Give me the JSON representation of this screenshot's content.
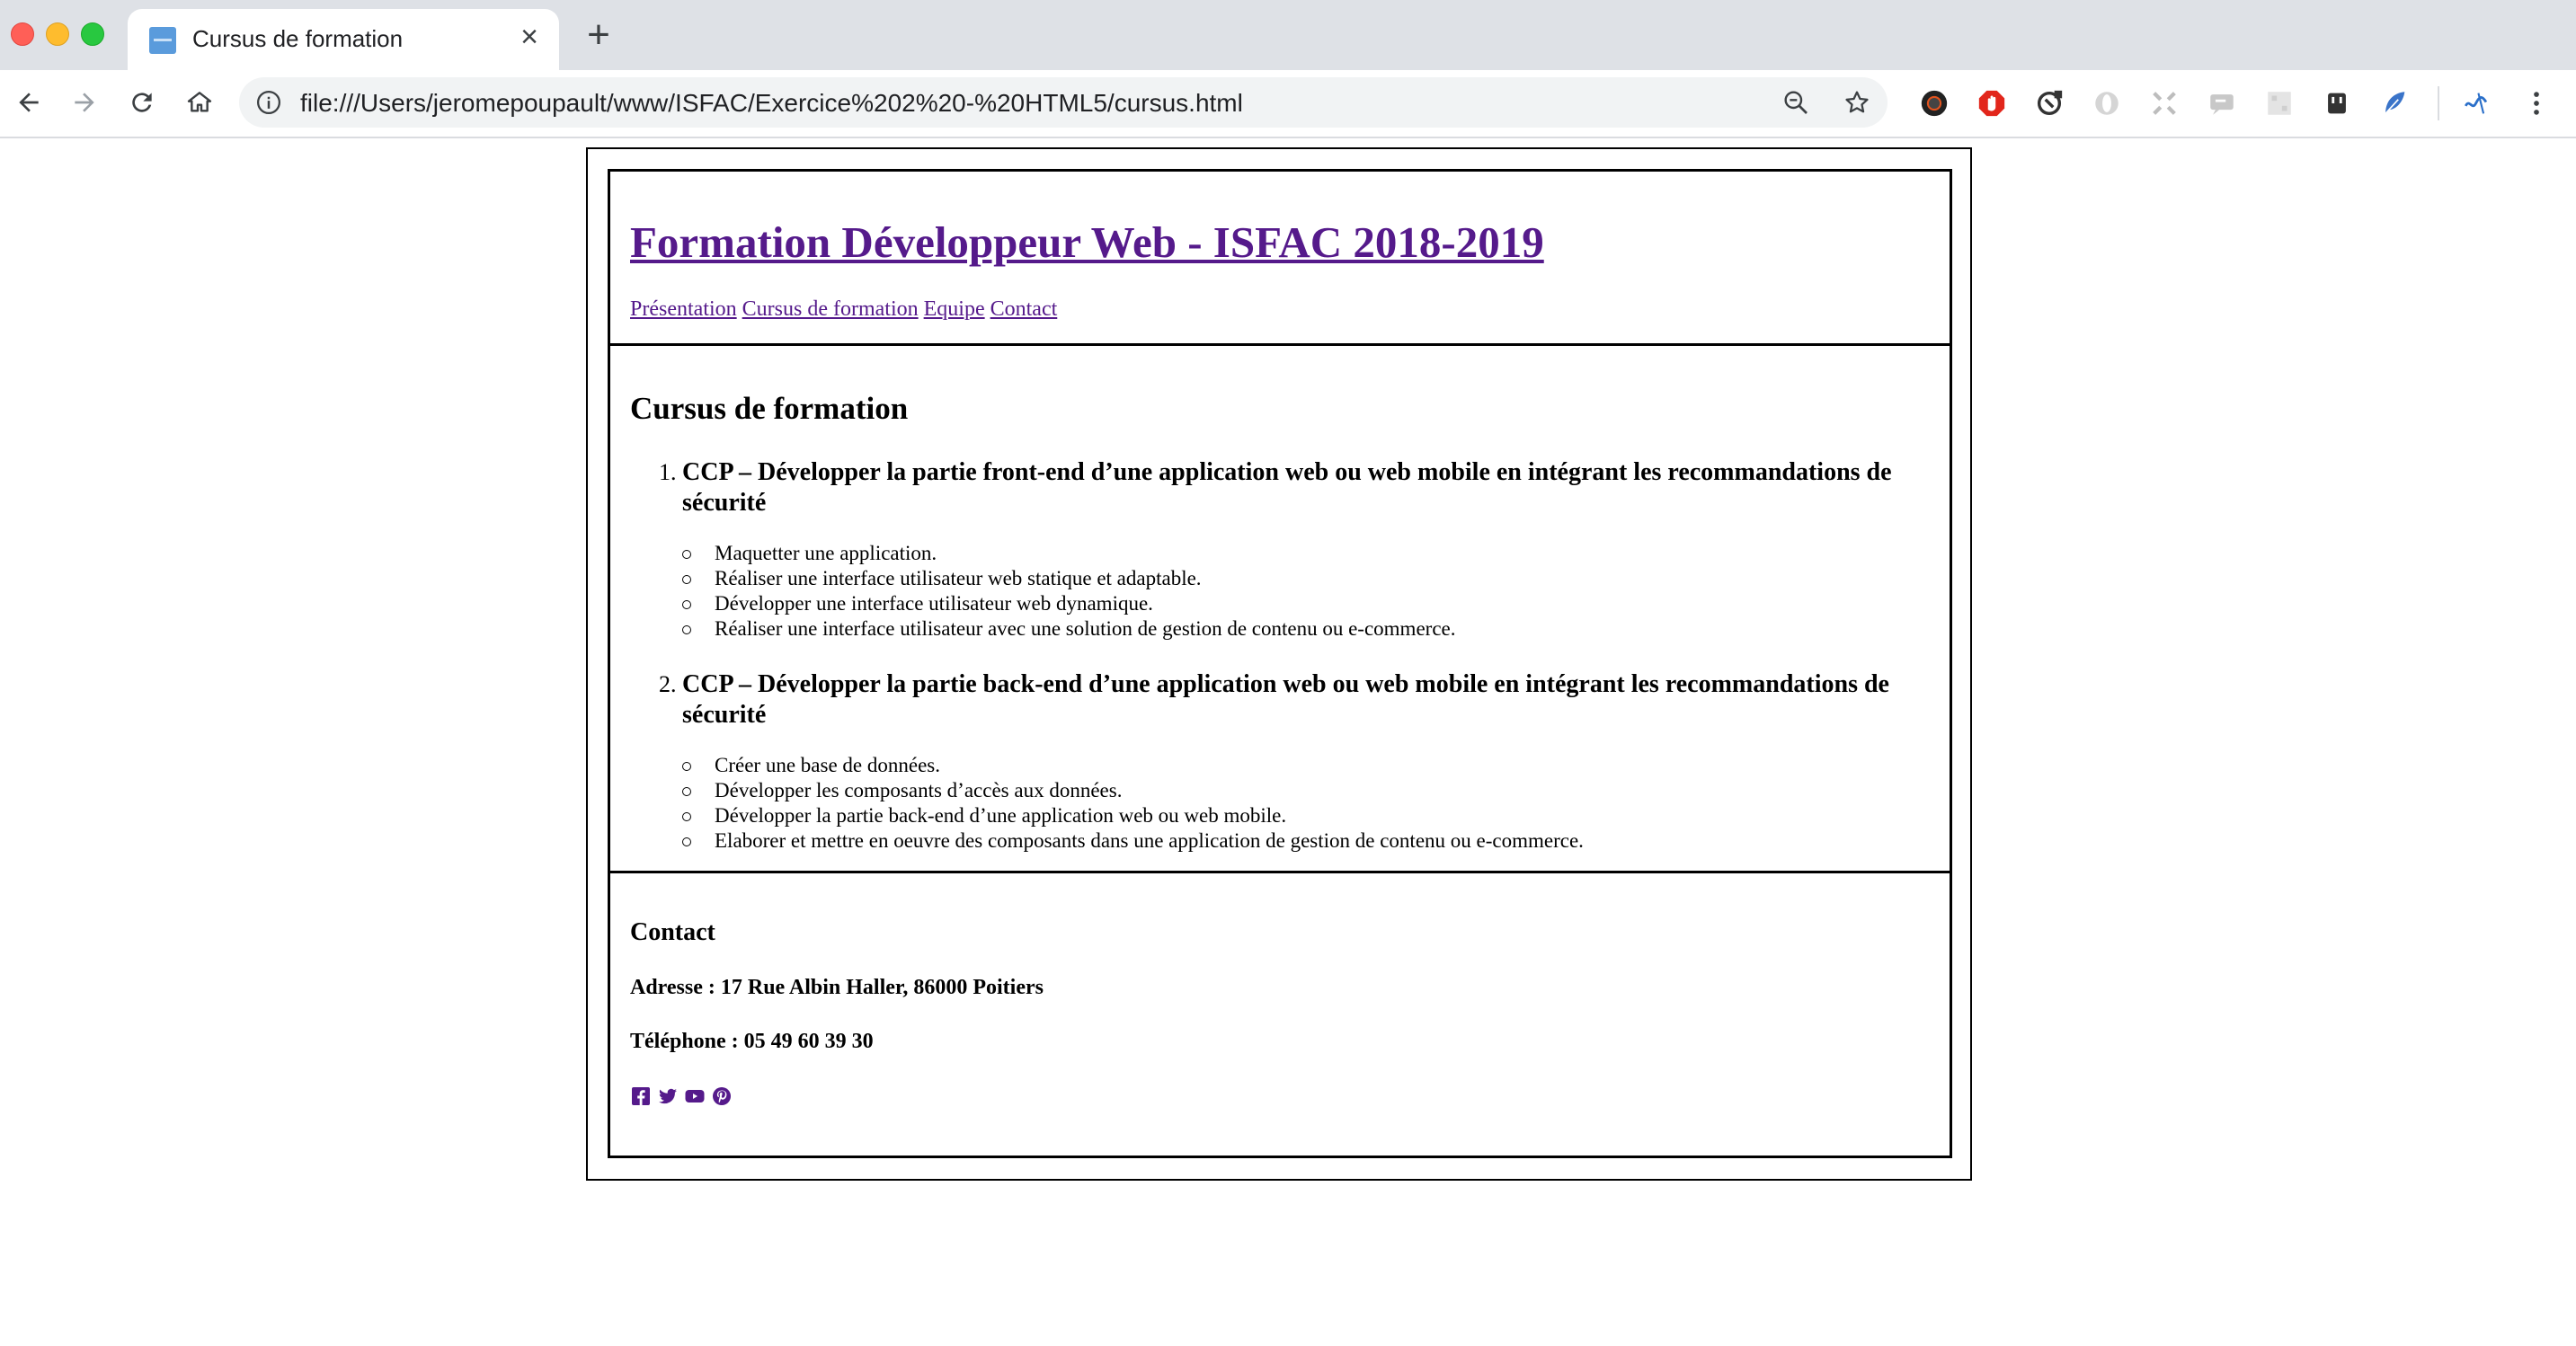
{
  "browser": {
    "tab_title": "Cursus de formation",
    "url": "file:///Users/jeromepoupault/www/ISFAC/Exercice%202%20-%20HTML5/cursus.html",
    "toolbar_icons": [
      "back-icon",
      "forward-icon",
      "reload-icon",
      "home-icon"
    ],
    "omnibox_icons": [
      "info-icon",
      "zoom-icon",
      "bookmark-star-icon"
    ],
    "extensions": [
      "camera-extension-icon",
      "adblock-extension-icon",
      "sync-extension-icon",
      "opera-extension-icon",
      "grid-extension-icon",
      "chat-extension-icon",
      "qr-extension-icon",
      "plug-extension-icon",
      "feather-extension-icon",
      "wave-extension-icon",
      "menu-dots-icon"
    ]
  },
  "header": {
    "title": "Formation Développeur Web - ISFAC 2018-2019",
    "nav": [
      {
        "label": "Présentation"
      },
      {
        "label": "Cursus de formation"
      },
      {
        "label": "Equipe"
      },
      {
        "label": "Contact"
      }
    ],
    "link_color": "#551a8b"
  },
  "main": {
    "title": "Cursus de formation",
    "modules": [
      {
        "number": "1.",
        "title": "CCP – Développer la partie front-end d’une application web ou web mobile en intégrant les recommandations de sécurité",
        "items": [
          "Maquetter une application.",
          "Réaliser une interface utilisateur web statique et adaptable.",
          "Développer une interface utilisateur web dynamique.",
          "Réaliser une interface utilisateur avec une solution de gestion de contenu ou e-commerce."
        ]
      },
      {
        "number": "2.",
        "title": "CCP – Développer la partie back-end d’une application web ou web mobile en intégrant les recommandations de sécurité",
        "items": [
          "Créer une base de données.",
          "Développer les composants d’accès aux données.",
          "Développer la partie back-end d’une application web ou web mobile.",
          "Elaborer et mettre en oeuvre des composants dans une application de gestion de contenu ou e-commerce."
        ]
      }
    ]
  },
  "footer": {
    "title": "Contact",
    "address": "Adresse : 17 Rue Albin Haller, 86000 Poitiers",
    "phone": "Téléphone : 05 49 60 39 30",
    "socials": [
      "facebook-icon",
      "twitter-icon",
      "youtube-icon",
      "pinterest-icon"
    ]
  }
}
